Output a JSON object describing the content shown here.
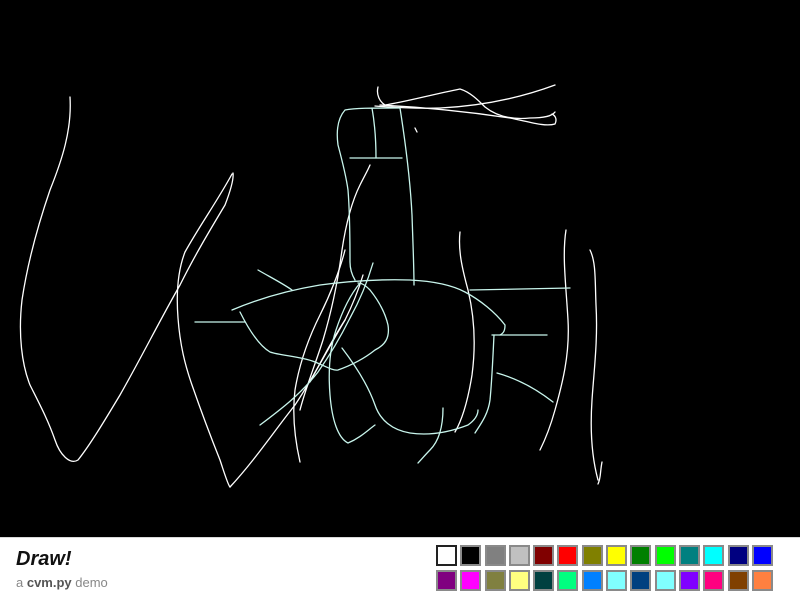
{
  "app": {
    "title": "Draw!",
    "subtitle_prefix": "a ",
    "subtitle_brand": "cvm.py",
    "subtitle_suffix": " demo"
  },
  "canvas": {
    "background": "#000000"
  },
  "palette": {
    "selected_index": 0,
    "colors": [
      "#ffffff",
      "#000000",
      "#808080",
      "#c0c0c0",
      "#800000",
      "#ff0000",
      "#808000",
      "#ffff00",
      "#008000",
      "#00ff00",
      "#008080",
      "#00ffff",
      "#000080",
      "#0000ff",
      "#800080",
      "#ff00ff",
      "#808040",
      "#ffff80",
      "#004040",
      "#00ff80",
      "#0080ff",
      "#80ffff",
      "#004080",
      "#80ffff",
      "#8000ff",
      "#ff0080",
      "#804000",
      "#ff8040"
    ]
  }
}
